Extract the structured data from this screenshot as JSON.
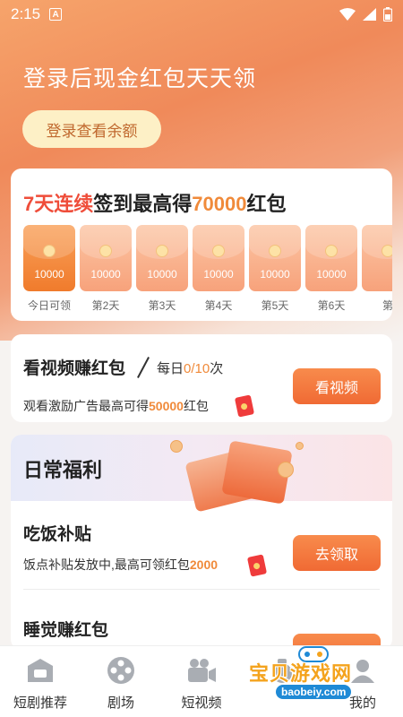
{
  "status_bar": {
    "time": "2:15",
    "notification_glyph": "A"
  },
  "hero": {
    "title": "登录后现金红包天天领",
    "login_button": "登录查看余额"
  },
  "signin": {
    "title_highlight": "7天连续",
    "title_mid": "签到最高得",
    "title_number": "70000",
    "title_suffix": "红包",
    "days": [
      {
        "amount": "10000",
        "label": "今日可领"
      },
      {
        "amount": "10000",
        "label": "第2天"
      },
      {
        "amount": "10000",
        "label": "第3天"
      },
      {
        "amount": "10000",
        "label": "第4天"
      },
      {
        "amount": "10000",
        "label": "第5天"
      },
      {
        "amount": "10000",
        "label": "第6天"
      },
      {
        "amount": "",
        "label": "第"
      }
    ]
  },
  "video": {
    "title": "看视频赚红包",
    "count_prefix": "每日",
    "count_value": "0/10",
    "count_suffix": "次",
    "desc_prefix": "观看激励广告最高可得",
    "desc_amount": "50000",
    "desc_suffix": "红包",
    "button": "看视频"
  },
  "welfare": {
    "title": "日常福利",
    "items": [
      {
        "title": "吃饭补贴",
        "desc_prefix": "饭点补贴发放中,最高可领红包",
        "desc_amount": "2000",
        "button": "去领取"
      },
      {
        "title": "睡觉赚红包"
      }
    ]
  },
  "bottom_nav": [
    {
      "label": "短剧推荐",
      "icon": "drama-icon"
    },
    {
      "label": "剧场",
      "icon": "film-reel-icon"
    },
    {
      "label": "短视频",
      "icon": "video-camera-icon"
    },
    {
      "label": "",
      "icon": "money-bag-icon"
    },
    {
      "label": "我的",
      "icon": "profile-icon"
    }
  ],
  "watermark": {
    "title": "宝贝游戏网",
    "url": "baobeiy.com"
  },
  "colors": {
    "accent": "#f06a34",
    "highlight_red": "#ef4d3a",
    "highlight_orange": "#f08a3a"
  }
}
